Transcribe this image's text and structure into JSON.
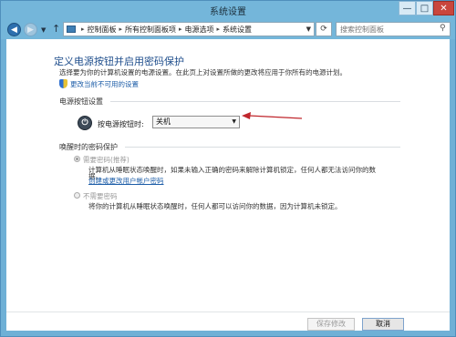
{
  "window": {
    "title": "系统设置",
    "controls": {
      "minimize": "—",
      "maximize": "□",
      "close": "✕"
    }
  },
  "nav": {
    "back_icon": "arrow-left-icon",
    "forward_icon": "arrow-right-icon",
    "up_icon": "arrow-up-icon",
    "breadcrumbs": [
      "控制面板",
      "所有控制面板项",
      "电源选项",
      "系统设置"
    ],
    "refresh_icon": "refresh-icon",
    "search_placeholder": "搜索控制面板"
  },
  "page": {
    "title": "定义电源按钮并启用密码保护",
    "description": "选择要为你的计算机设置的电源设置。在此页上对设置所做的更改将应用于你所有的电源计划。",
    "change_link": "更改当前不可用的设置"
  },
  "power_section": {
    "heading": "电源按钮设置",
    "label": "按电源按钮时:",
    "selected": "关机"
  },
  "wake_section": {
    "heading": "唤醒时的密码保护",
    "option_require": {
      "label": "需要密码(推荐)",
      "desc_line1": "计算机从睡眠状态唤醒时，如果未输入正确的密码来解除计算机锁定，任何人都无法访问你的数",
      "desc_line2": "据。",
      "link": "创建或更改用户帐户密码"
    },
    "option_no_require": {
      "label": "不需要密码",
      "desc": "将你的计算机从睡眠状态唤醒时，任何人都可以访问你的数据，因为计算机未锁定。"
    }
  },
  "buttons": {
    "save": "保存修改",
    "cancel": "取消"
  },
  "colors": {
    "accent_link": "#1e5ea8",
    "annotation_arrow": "#c0272d",
    "title_blue": "#1f4e8c"
  }
}
